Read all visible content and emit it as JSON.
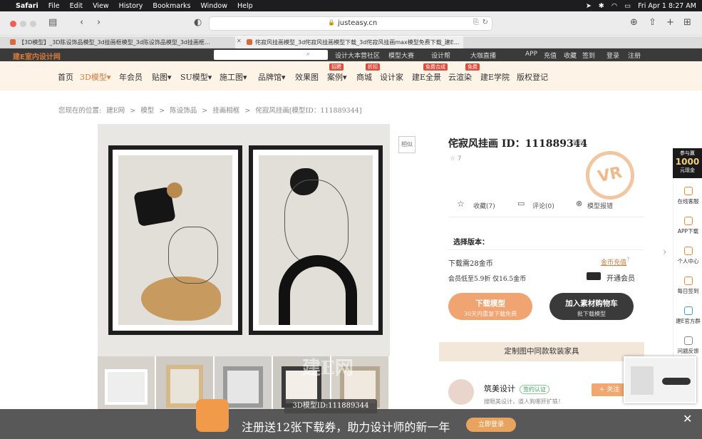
{
  "menubar": {
    "app": "Safari",
    "items": [
      "File",
      "Edit",
      "View",
      "History",
      "Bookmarks",
      "Window",
      "Help"
    ],
    "datetime": "Fri Apr 1  8:27 AM"
  },
  "browser": {
    "url": "justeasy.cn",
    "tabs": [
      "【3D模型】_3D陈设饰品模型_3d挂画框模型_3d陈设饰品模型_3d挂画框...",
      "侘寂风挂画模型_3d侘寂风挂画模型下载_3d侘寂风挂画max模型免费下载_建E..."
    ]
  },
  "site": {
    "top_links": [
      "设计大本营社区",
      "模型大赛",
      "设计帮",
      "大咖直播",
      "APP",
      "充值",
      "收藏",
      "签到",
      "登录",
      "注册"
    ],
    "nav": [
      {
        "label": "首页",
        "active": false,
        "badge": ""
      },
      {
        "label": "3D模型▾",
        "active": true,
        "badge": ""
      },
      {
        "label": "年会员",
        "active": false,
        "badge": ""
      },
      {
        "label": "贴图▾",
        "active": false,
        "badge": ""
      },
      {
        "label": "SU模型▾",
        "active": false,
        "badge": ""
      },
      {
        "label": "施工图▾",
        "active": false,
        "badge": ""
      },
      {
        "label": "品牌馆▾",
        "active": false,
        "badge": ""
      },
      {
        "label": "效果图",
        "active": false,
        "badge": ""
      },
      {
        "label": "案例▾",
        "active": false,
        "badge": "招聘"
      },
      {
        "label": "商城",
        "active": false,
        "badge": "折扣"
      },
      {
        "label": "设计家",
        "active": false,
        "badge": ""
      },
      {
        "label": "建E全景",
        "active": false,
        "badge": "免费合成"
      },
      {
        "label": "云渲染",
        "active": false,
        "badge": "免费"
      },
      {
        "label": "建E学院",
        "active": false,
        "badge": ""
      },
      {
        "label": "版权登记",
        "active": false,
        "badge": ""
      }
    ],
    "breadcrumb": [
      "您现在的位置:",
      "建E网",
      ">",
      "模型",
      ">",
      "陈设饰品",
      ">",
      "挂画相框",
      ">",
      "侘寂风挂画[模型ID：111889344]"
    ]
  },
  "product": {
    "title": "侘寂风挂画  ID：111889344",
    "copy": "复制",
    "rating": "☆ 7",
    "vr": "VR",
    "actions": [
      {
        "icon": "star-icon",
        "label": "收藏(7)"
      },
      {
        "icon": "comment-icon",
        "label": "评论(0)"
      },
      {
        "icon": "report-icon",
        "label": "模型报错"
      }
    ],
    "version_label": "选择版本：",
    "price_line": "下载需28金币",
    "recharge": "金币充值",
    "member_line": "会员低至5.9折 仅16.5金币",
    "open_vip": "开通会员",
    "download_btn": {
      "line1": "下载模型",
      "line2": "30天内重复下载免费"
    },
    "cart_btn": {
      "line1": "加入素材购物车",
      "line2": "批下载模型"
    },
    "custom_bar": "定制图中同款软装家具",
    "designer": {
      "name": "筑美设计",
      "cert": "签约认证",
      "desc": "搜眼美设计，道人狗哪肝扩轶！",
      "follow": "+ 关注"
    },
    "model_id": "3D模型ID:111889344",
    "side_label": "相似",
    "watermark": "建E网"
  },
  "sidebar": {
    "promo_top": "参与赢",
    "promo_num": "1000",
    "promo_sub": "元现金",
    "items": [
      "在线客服",
      "APP下载",
      "个人中心",
      "每日签到",
      "建E官方群",
      "问题反馈"
    ]
  },
  "banner": {
    "text": "注册送12张下载券，助力设计师的新一年",
    "button": "立即登录",
    "close": "✕"
  },
  "colors": {
    "accent": "#d67a3e",
    "download_btn": "#f0a472",
    "cart_btn": "#3a3a3a"
  }
}
